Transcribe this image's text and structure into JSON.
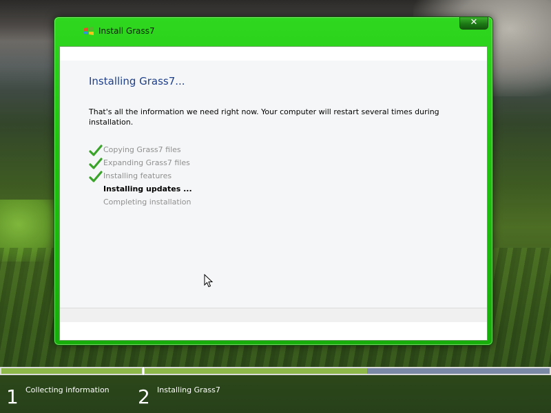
{
  "window": {
    "title": "Install Grass7",
    "close_label": "✕"
  },
  "content": {
    "heading": "Installing Grass7...",
    "description": "That's all the information we need right now. Your computer will restart several times during installation.",
    "steps": [
      {
        "label": "Copying Grass7 files",
        "status": "done"
      },
      {
        "label": "Expanding Grass7 files",
        "status": "done"
      },
      {
        "label": "Installing features",
        "status": "done"
      },
      {
        "label": "Installing updates ...",
        "status": "active"
      },
      {
        "label": "Completing installation",
        "status": "pending"
      }
    ]
  },
  "progress": {
    "stage1": {
      "number": "1",
      "label": "Collecting information",
      "fraction": 1.0
    },
    "stage2": {
      "number": "2",
      "label": "Installing Grass7",
      "fraction": 0.55
    }
  },
  "colors": {
    "accent": "#1fc30f",
    "progress_fill": "#8eb94a",
    "progress_remaining": "#7a89a5",
    "heading": "#1e3f8a"
  },
  "icons": [
    "windows-logo-icon",
    "close-icon",
    "checkmark-icon",
    "mouse-cursor-icon"
  ]
}
